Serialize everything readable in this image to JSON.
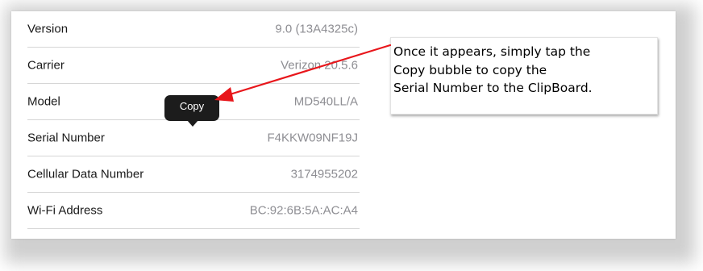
{
  "rows": [
    {
      "label": "Version",
      "value": "9.0 (13A4325c)"
    },
    {
      "label": "Carrier",
      "value": "Verizon 20.5.6"
    },
    {
      "label": "Model",
      "value": "MD540LL/A"
    },
    {
      "label": "Serial Number",
      "value": "F4KKW09NF19J"
    },
    {
      "label": "Cellular Data Number",
      "value": "3174955202"
    },
    {
      "label": "Wi-Fi Address",
      "value": "BC:92:6B:5A:AC:A4"
    }
  ],
  "copy_bubble": {
    "label": "Copy"
  },
  "callout": {
    "lines": [
      "Once it appears, simply tap the",
      "Copy bubble to copy the",
      "Serial Number to the ClipBoard."
    ]
  },
  "colors": {
    "label_text": "#1a1a1a",
    "value_text": "#8e8e93",
    "separator": "#d6d6d6",
    "bubble_bg": "#1c1c1c",
    "arrow": "#e8161b"
  },
  "icons": {
    "annotation_arrow": "red-arrow-icon"
  }
}
